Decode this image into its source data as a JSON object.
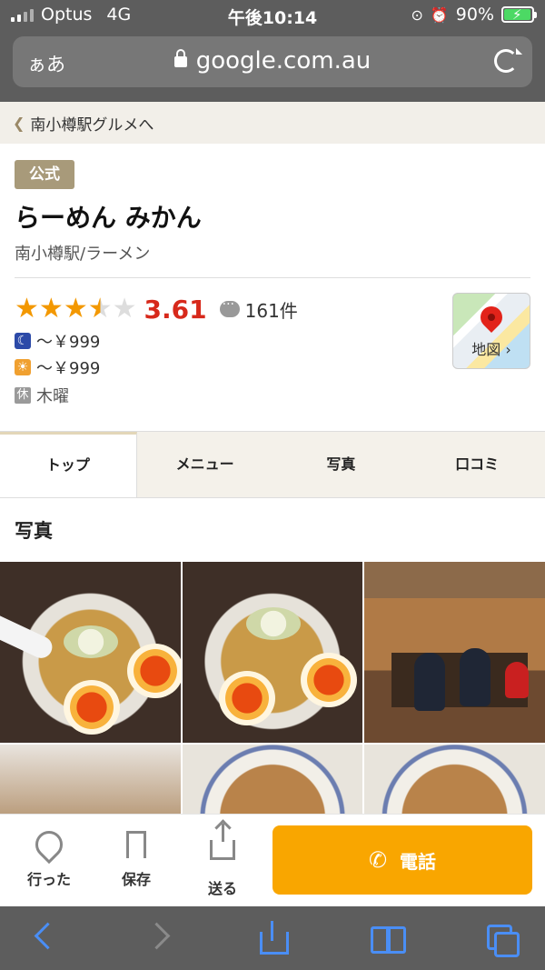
{
  "status": {
    "carrier": "Optus",
    "network": "4G",
    "time": "午後10:14",
    "battery": "90%",
    "battery_level": 0.9
  },
  "browser": {
    "text_size": "ぁあ",
    "url": "google.com.au"
  },
  "breadcrumb": {
    "label": "南小樽駅グルメへ"
  },
  "store": {
    "badge": "公式",
    "name": "らーめん みかん",
    "category": "南小樽駅/ラーメン",
    "rating": 3.61,
    "rating_text": "3.61",
    "review_count": "161件",
    "dinner_price": "～￥999",
    "lunch_price": "～￥999",
    "holiday_icon": "休",
    "holiday": "木曜",
    "map_label": "地図",
    "map_chevron": "›"
  },
  "tabs": [
    {
      "label": "トップ",
      "active": true
    },
    {
      "label": "メニュー",
      "active": false
    },
    {
      "label": "写真",
      "active": false
    },
    {
      "label": "口コミ",
      "active": false
    }
  ],
  "photos_section": {
    "title": "写真"
  },
  "actions": {
    "visited": "行った",
    "save": "保存",
    "share": "送る",
    "call": "電話"
  },
  "colors": {
    "accent": "#f9a600",
    "score": "#d7291b",
    "star": "#f39800",
    "chrome": "#5d5d5d"
  }
}
